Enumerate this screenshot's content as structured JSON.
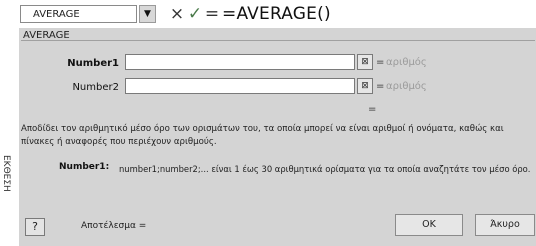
{
  "side_strip": "ΕΚΘΕΣΗ",
  "formula_bar": {
    "name_box": "AVERAGE",
    "dropdown_icon": "triangle-down",
    "cancel_icon": "×",
    "enter_icon": "✓",
    "edit_icon": "=",
    "formula": "=AVERAGE()"
  },
  "dialog": {
    "function_name": "AVERAGE",
    "arguments": [
      {
        "label": "Number1",
        "value": "",
        "result": "αριθμός"
      },
      {
        "label": "Number2",
        "value": "",
        "result": "αριθμός"
      }
    ],
    "collapse_icon": "⊠",
    "equals": "=",
    "result_equals": "=",
    "description": "Αποδίδει τον αριθμητικό μέσο όρο των ορισμάτων του, τα οποία μπορεί να είναι αριθμοί ή ονόματα, καθώς και πίνακες ή αναφορές που περιέχουν αριθμούς.",
    "arg_help_name": "Number1:",
    "arg_help_text": "number1;number2;... είναι 1 έως 30 αριθμητικά ορίσματα για τα οποία αναζητάτε τον μέσο όρο.",
    "help_icon": "?",
    "result_label": "Αποτέλεσμα =",
    "ok_label": "OK",
    "cancel_label": "Άκυρο"
  }
}
